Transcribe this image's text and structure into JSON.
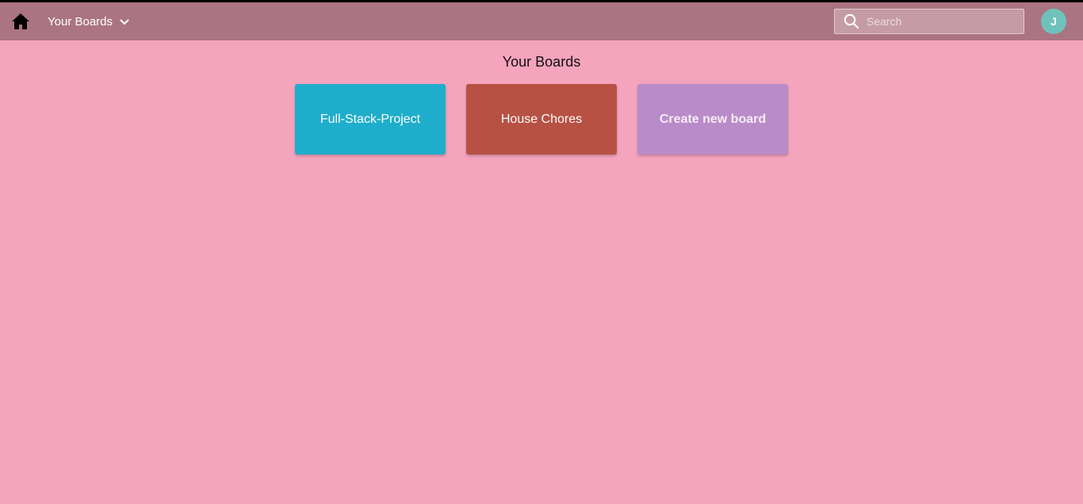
{
  "navbar": {
    "menu_label": "Your Boards",
    "search_placeholder": "Search",
    "avatar_initial": "J",
    "icons": [
      "home-icon",
      "chevron-down-icon",
      "search-icon"
    ]
  },
  "main": {
    "title": "Your Boards",
    "boards": [
      {
        "name": "Full-Stack-Project",
        "color": "#1fadcc"
      },
      {
        "name": "House Chores",
        "color": "#b75143"
      }
    ],
    "create_board": {
      "label": "Create new board",
      "color": "#ba8bc9"
    }
  },
  "colors": {
    "background": "#f4a4bd",
    "navbar": "#ab7482",
    "avatar": "#6fc2bb"
  }
}
